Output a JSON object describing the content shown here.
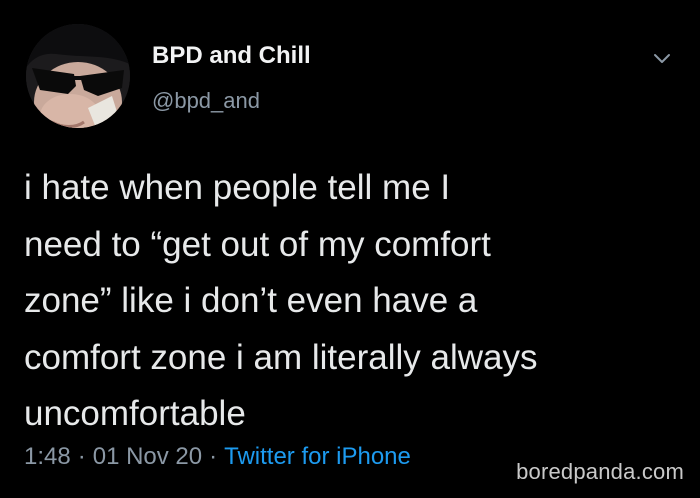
{
  "user": {
    "display_name": "BPD and Chill",
    "handle": "@bpd_and",
    "avatar_icon": "profile-photo"
  },
  "menu": {
    "icon": "chevron-down-icon",
    "color": "#8b98a5"
  },
  "tweet": {
    "lines": [
      "i hate when people tell me I",
      "need to “get out of my comfort",
      "zone” like i don’t even have a",
      "comfort zone i am literally always",
      "uncomfortable"
    ]
  },
  "meta": {
    "time": "1:48",
    "separator": "·",
    "date": "01 Nov 20",
    "source": "Twitter for iPhone"
  },
  "watermark": "boredpanda.com",
  "colors": {
    "background": "#000000",
    "text": "#e7e9ea",
    "secondary": "#8b98a5",
    "link": "#1d9bf0"
  }
}
